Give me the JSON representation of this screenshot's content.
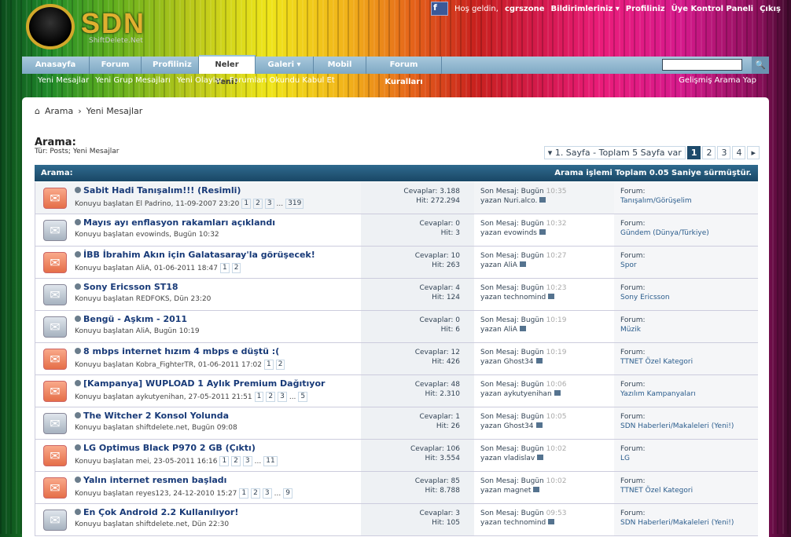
{
  "logo": {
    "text": "SDN",
    "subtitle": "ShiftDelete.Net"
  },
  "toplinks": {
    "welcome": "Hoş geldin,",
    "user": "cgrszone",
    "notifications": "Bildirimleriniz ▾",
    "profile": "Profiliniz",
    "ucp": "Üye Kontrol Paneli",
    "logout": "Çıkış"
  },
  "nav": {
    "tabs": [
      "Anasayfa",
      "Forum",
      "Profiliniz",
      "Neler Yeni?",
      "Galeri ▾",
      "Mobil",
      "Forum Kuralları"
    ],
    "search_button": "🔍"
  },
  "subnav": {
    "items": [
      "Yeni Mesajlar",
      "Yeni Grup Mesajları",
      "Yeni Olaylar",
      "Forumları Okundu Kabul Et"
    ],
    "advanced": "Gelişmiş Arama Yap"
  },
  "breadcrumb": {
    "home": "⌂",
    "items": [
      "Arama",
      "Yeni Mesajlar"
    ]
  },
  "heading": {
    "title": "Arama:",
    "subtitle": "Tür: Posts; Yeni Mesajlar"
  },
  "pager": {
    "label": "▾ 1. Sayfa - Toplam 5 Sayfa var",
    "pages": [
      "1",
      "2",
      "3",
      "4"
    ],
    "next": "▸"
  },
  "table": {
    "header_left": "Arama:",
    "header_right": "Arama işlemi Toplam 0.05 Saniye sürmüştür."
  },
  "rows": [
    {
      "title": "Sabit Hadi Tanışalım!!! (Resimli)",
      "meta": "Konuyu başlatan El Padrino, 11-09-2007 23:20",
      "pages": [
        "1",
        "2",
        "3",
        "...",
        "319"
      ],
      "replies": "Cevaplar: 3.188",
      "hits": "Hit: 272.294",
      "last_label": "Son Mesaj: Bugün",
      "last_time": "10:35",
      "last_by": "yazan Nuri.alco.",
      "forum": "Tanışalım/Görüşelim",
      "hot": true
    },
    {
      "title": "Mayıs ayı enflasyon rakamları açıklandı",
      "meta": "Konuyu başlatan evowinds, Bugün 10:32",
      "pages": [],
      "replies": "Cevaplar: 0",
      "hits": "Hit: 3",
      "last_label": "Son Mesaj: Bugün",
      "last_time": "10:32",
      "last_by": "yazan evowinds",
      "forum": "Gündem (Dünya/Türkiye)",
      "hot": false
    },
    {
      "title": "İBB İbrahim Akın için Galatasaray'la görüşecek!",
      "meta": "Konuyu başlatan AliA, 01-06-2011 18:47",
      "pages": [
        "1",
        "2"
      ],
      "replies": "Cevaplar: 10",
      "hits": "Hit: 263",
      "last_label": "Son Mesaj: Bugün",
      "last_time": "10:27",
      "last_by": "yazan AliA",
      "forum": "Spor",
      "hot": true
    },
    {
      "title": "Sony Ericsson ST18",
      "meta": "Konuyu başlatan REDFOKS, Dün 23:20",
      "pages": [],
      "replies": "Cevaplar: 4",
      "hits": "Hit: 124",
      "last_label": "Son Mesaj: Bugün",
      "last_time": "10:23",
      "last_by": "yazan technomind",
      "forum": "Sony Ericsson",
      "hot": false
    },
    {
      "title": "Bengü - Aşkım - 2011",
      "meta": "Konuyu başlatan AliA, Bugün 10:19",
      "pages": [],
      "replies": "Cevaplar: 0",
      "hits": "Hit: 6",
      "last_label": "Son Mesaj: Bugün",
      "last_time": "10:19",
      "last_by": "yazan AliA",
      "forum": "Müzik",
      "hot": false
    },
    {
      "title": "8 mbps internet hızım 4 mbps e düştü :(",
      "meta": "Konuyu başlatan Kobra_FighterTR, 01-06-2011 17:02",
      "pages": [
        "1",
        "2"
      ],
      "replies": "Cevaplar: 12",
      "hits": "Hit: 426",
      "last_label": "Son Mesaj: Bugün",
      "last_time": "10:19",
      "last_by": "yazan Ghost34",
      "forum": "TTNET Özel Kategori",
      "hot": true
    },
    {
      "title": "[Kampanya] WUPLOAD 1 Aylık Premium Dağıtıyor",
      "meta": "Konuyu başlatan aykutyenihan, 27-05-2011 21:51",
      "pages": [
        "1",
        "2",
        "3",
        "...",
        "5"
      ],
      "replies": "Cevaplar: 48",
      "hits": "Hit: 2.310",
      "last_label": "Son Mesaj: Bugün",
      "last_time": "10:06",
      "last_by": "yazan aykutyenihan",
      "forum": "Yazılım Kampanyaları",
      "hot": true
    },
    {
      "title": "The Witcher 2 Konsol Yolunda",
      "meta": "Konuyu başlatan shiftdelete.net, Bugün 09:08",
      "pages": [],
      "replies": "Cevaplar: 1",
      "hits": "Hit: 26",
      "last_label": "Son Mesaj: Bugün",
      "last_time": "10:05",
      "last_by": "yazan Ghost34",
      "forum": "SDN Haberleri/Makaleleri (Yeni!)",
      "hot": false
    },
    {
      "title": "LG Optimus Black P970 2 GB (Çıktı)",
      "meta": "Konuyu başlatan mei, 23-05-2011 16:16",
      "pages": [
        "1",
        "2",
        "3",
        "...",
        "11"
      ],
      "replies": "Cevaplar: 106",
      "hits": "Hit: 3.554",
      "last_label": "Son Mesaj: Bugün",
      "last_time": "10:02",
      "last_by": "yazan vladislav",
      "forum": "LG",
      "hot": true
    },
    {
      "title": "Yalın internet resmen başladı",
      "meta": "Konuyu başlatan reyes123, 24-12-2010 15:27",
      "pages": [
        "1",
        "2",
        "3",
        "...",
        "9"
      ],
      "replies": "Cevaplar: 85",
      "hits": "Hit: 8.788",
      "last_label": "Son Mesaj: Bugün",
      "last_time": "10:02",
      "last_by": "yazan magnet",
      "forum": "TTNET Özel Kategori",
      "hot": true
    },
    {
      "title": "En Çok Android 2.2 Kullanılıyor!",
      "meta": "Konuyu başlatan shiftdelete.net, Dün 22:30",
      "pages": [],
      "replies": "Cevaplar: 3",
      "hits": "Hit: 105",
      "last_label": "Son Mesaj: Bugün",
      "last_time": "09:53",
      "last_by": "yazan technomind",
      "forum": "SDN Haberleri/Makaleleri (Yeni!)",
      "hot": false
    }
  ],
  "forum_label": "Forum:"
}
